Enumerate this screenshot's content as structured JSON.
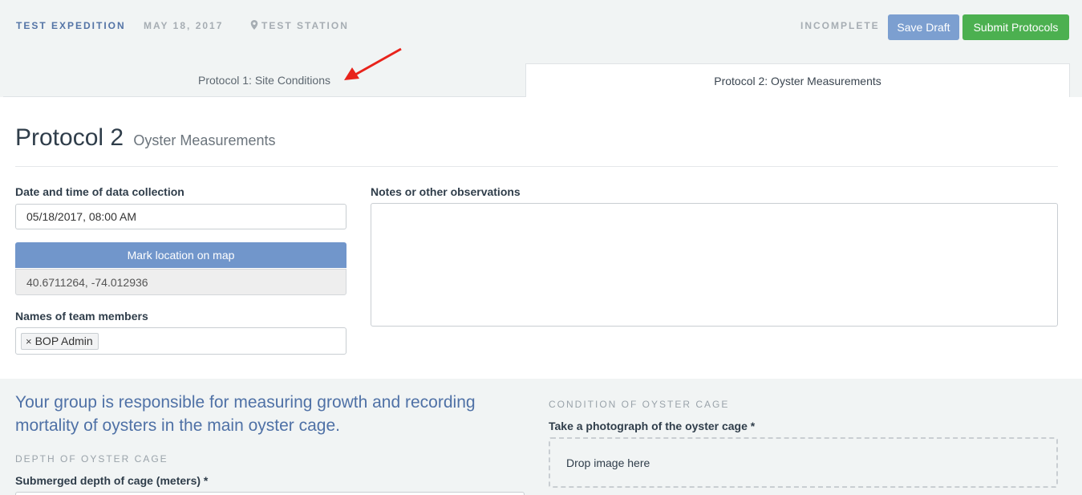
{
  "header": {
    "expedition": "TEST EXPEDITION",
    "date": "MAY 18, 2017",
    "station": "TEST STATION",
    "status": "INCOMPLETE",
    "save_draft": "Save Draft",
    "submit": "Submit Protocols"
  },
  "tabs": [
    {
      "label": "Protocol 1: Site Conditions"
    },
    {
      "label": "Protocol 2: Oyster Measurements"
    }
  ],
  "protocol": {
    "title": "Protocol 2",
    "subtitle": "Oyster Measurements"
  },
  "form": {
    "datetime_label": "Date and time of data collection",
    "datetime_value": "05/18/2017, 08:00 AM",
    "map_button": "Mark location on map",
    "coordinates": "40.6711264, -74.012936",
    "team_label": "Names of team members",
    "team_members": [
      "BOP Admin"
    ],
    "notes_label": "Notes or other observations",
    "notes_value": ""
  },
  "lower": {
    "intro": "Your group is responsible for measuring growth and recording mortality of oysters in the main oyster cage.",
    "depth_heading": "DEPTH OF OYSTER CAGE",
    "depth_label": "Submerged depth of cage (meters) *",
    "condition_heading": "CONDITION OF OYSTER CAGE",
    "photo_label": "Take a photograph of the oyster cage *",
    "drop_text": "Drop image here"
  },
  "colors": {
    "accent_blue": "#7196cb",
    "submit_green": "#4cb050",
    "annotation_arrow": "#e8231b"
  },
  "icons": {
    "station": "map-pin-icon",
    "tag_remove": "close-icon"
  }
}
